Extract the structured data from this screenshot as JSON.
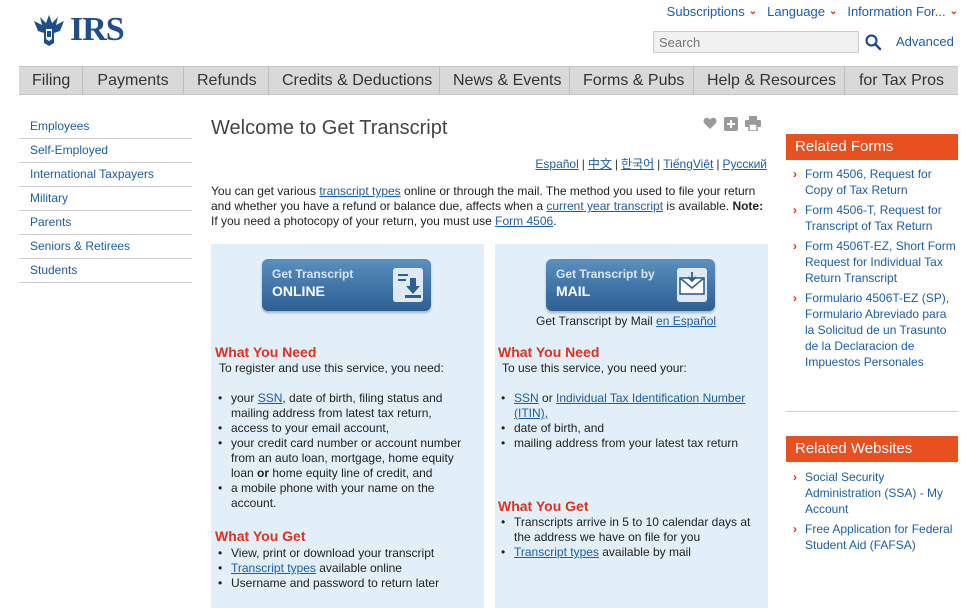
{
  "header": {
    "logo_text": "IRS",
    "top_links": [
      "Subscriptions",
      "Language",
      "Information For..."
    ],
    "search_placeholder": "Search",
    "advanced_label": "Advanced"
  },
  "nav": [
    "Filing",
    "Payments",
    "Refunds",
    "Credits & Deductions",
    "News & Events",
    "Forms & Pubs",
    "Help & Resources",
    "for Tax Pros"
  ],
  "sidebar": [
    "Employees",
    "Self-Employed",
    "International Taxpayers",
    "Military",
    "Parents",
    "Seniors & Retirees",
    "Students"
  ],
  "main": {
    "title": "Welcome to Get Transcript",
    "languages": [
      "Español",
      "中文",
      "한국어",
      "TiếngViệt",
      "Русский"
    ],
    "intro": {
      "p1": "You can get various ",
      "link1": "transcript types",
      "p2": " online or through the mail. The method you used to file your return and whether you have a refund or balance due, affects when a ",
      "link2": "current year transcript",
      "p3": " is available. ",
      "note_label": "Note:",
      "p4": " If you need a photocopy of your return, you must use ",
      "link3": "Form 4506",
      "p5": "."
    },
    "online": {
      "btn_line1": "Get Transcript",
      "btn_line2": "ONLINE",
      "need_head": "What You Need",
      "need_sub": "To register and use this service, you need:",
      "need_items": {
        "a_pre": "your ",
        "a_link": "SSN",
        "a_post": ", date of birth, filing status and mailing address from latest tax return,",
        "b": "access to your email account,",
        "c_pre": "your credit card number or account number from an auto loan, mortgage, home equity loan ",
        "c_bold": "or",
        "c_post": " home equity line of credit, and",
        "d": "a mobile phone with your name on the account."
      },
      "get_head": "What You Get",
      "get_items": {
        "a": "View, print or download your transcript",
        "b_link": "Transcript types",
        "b_post": " available online",
        "c": "Username and password to return later"
      }
    },
    "mail": {
      "btn_line1": "Get Transcript by",
      "btn_line2": "MAIL",
      "subtitle_pre": "Get Transcript by Mail ",
      "subtitle_link": "en Español",
      "need_head": "What You Need",
      "need_sub": "To use this service, you need your:",
      "need_items": {
        "a_link1": "SSN",
        "a_mid": " or ",
        "a_link2": "Individual Tax Identification Number (ITIN),",
        "b": "date of birth, and",
        "c": "mailing address from your latest tax return"
      },
      "get_head": "What You Get",
      "get_items": {
        "a": "Transcripts arrive in 5 to 10 calendar days at the  address we have on file for you",
        "b_link": "Transcript types",
        "b_post": " available by mail"
      }
    }
  },
  "related_forms": {
    "title": "Related Forms",
    "items": [
      "Form 4506, Request for Copy of Tax Return",
      "Form 4506-T, Request for Transcript of Tax Return",
      "Form 4506T-EZ, Short Form Request for Individual Tax Return Transcript",
      "Formulario 4506T-EZ (SP), Formulario Abreviado para la Solicitud de un Trasunto de la Declaracion de Impuestos Personales"
    ]
  },
  "related_websites": {
    "title": "Related Websites",
    "items": [
      "Social Security Administration (SSA) - My Account",
      "Free Application for Federal Student Aid (FAFSA)"
    ]
  },
  "colors": {
    "accent": "#e9501f",
    "link": "#1a5ea8",
    "panel": "#e2eef8",
    "nav": "#d9d9d9"
  }
}
